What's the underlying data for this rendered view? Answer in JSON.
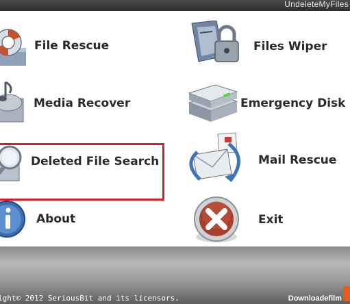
{
  "window": {
    "title": "UndeleteMyFiles"
  },
  "menu": {
    "file_rescue": "File Rescue",
    "media_recover": "Media Recover",
    "deleted_file_search": "Deleted File Search",
    "about": "About",
    "files_wiper": "Files Wiper",
    "emergency_disk_image": "Emergency Disk Im",
    "mail_rescue": "Mail Rescue",
    "exit": "Exit"
  },
  "icons": {
    "file_rescue": "lifebuoy-icon",
    "media_recover": "media-icon",
    "deleted_file_search": "magnifier-icon",
    "about": "info-icon",
    "files_wiper": "locked-folder-icon",
    "emergency_disk_image": "hard-disk-icon",
    "mail_rescue": "mail-icon",
    "exit": "exit-icon"
  },
  "colors": {
    "highlight": "#d0202a",
    "titlebar": "#3a3a3a"
  },
  "footer": {
    "copyright": "ight© 2012 SeriousBit and its licensors.",
    "watermark": "Downloadefilm"
  }
}
